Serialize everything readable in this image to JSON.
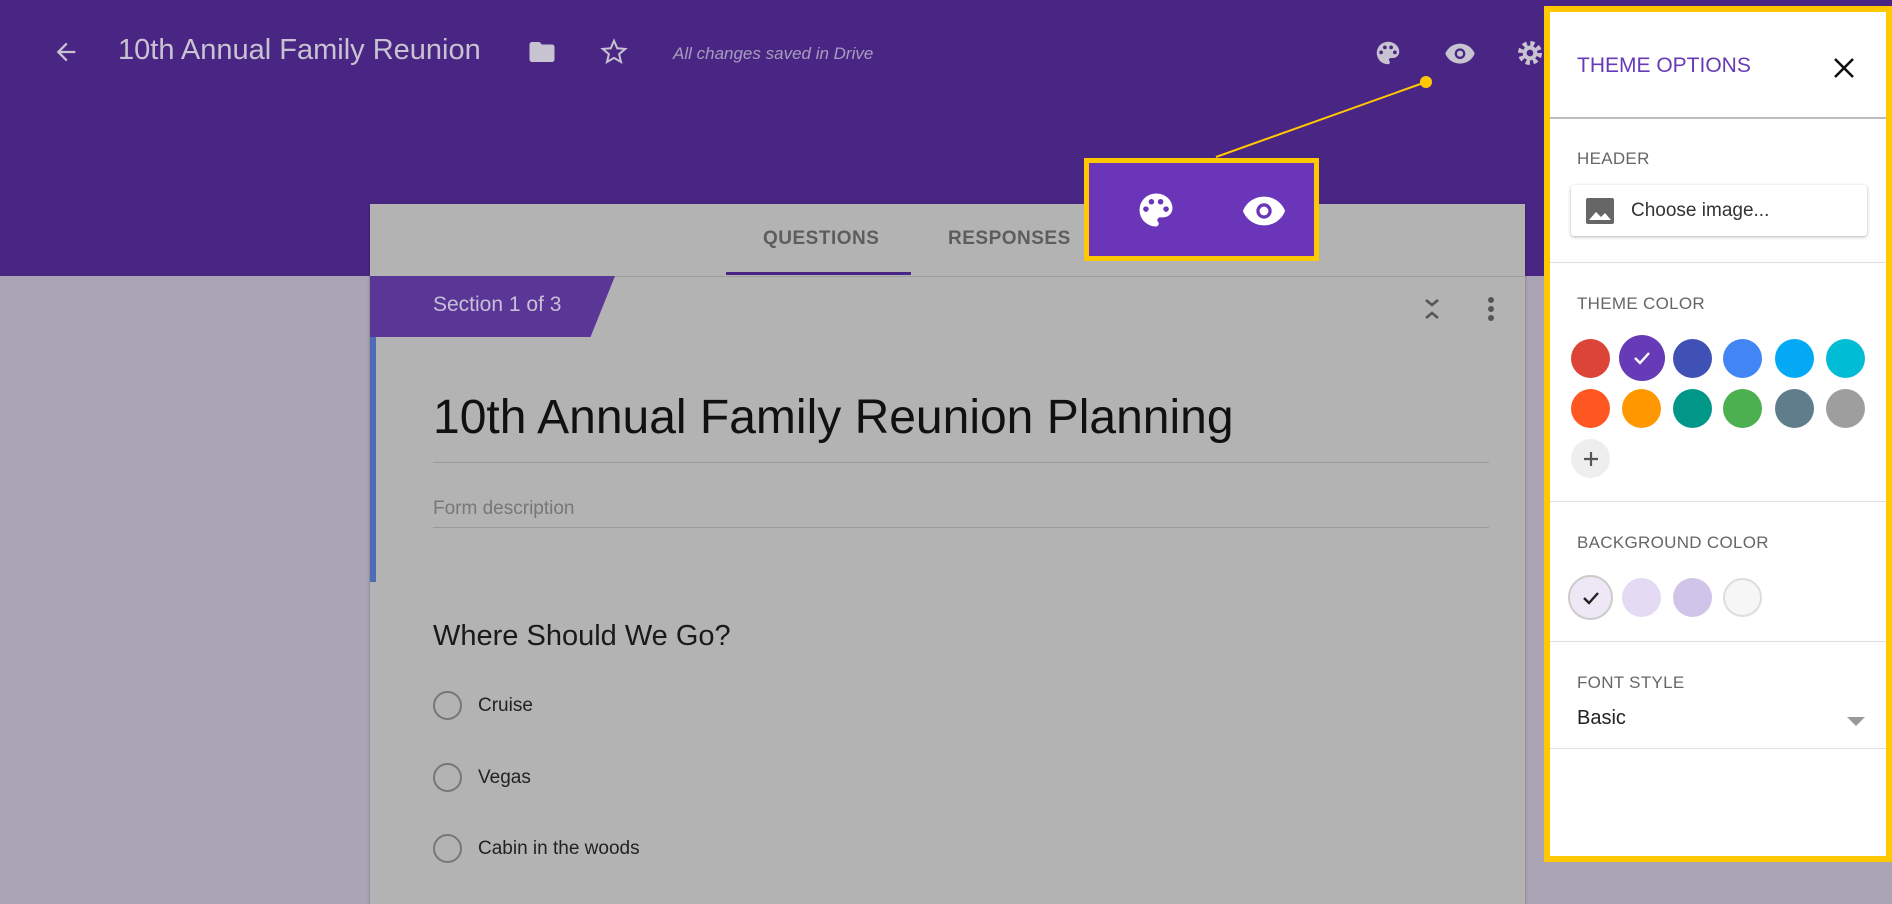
{
  "topbar": {
    "title": "10th Annual Family Reunion",
    "saved_status": "All changes saved in Drive",
    "icons": [
      "back-arrow-icon",
      "folder-icon",
      "star-icon",
      "palette-icon",
      "eye-icon",
      "gear-icon"
    ]
  },
  "tabs": [
    {
      "label": "QUESTIONS",
      "active": true
    },
    {
      "label": "RESPONSES",
      "active": false
    }
  ],
  "section": {
    "label": "Section 1 of 3"
  },
  "form": {
    "title": "10th Annual Family Reunion Planning",
    "description_placeholder": "Form description",
    "question": {
      "title": "Where Should We Go?",
      "options": [
        "Cruise",
        "Vegas",
        "Cabin in the woods"
      ]
    }
  },
  "panel": {
    "title": "THEME OPTIONS",
    "header_label": "HEADER",
    "choose_image": "Choose image...",
    "theme_color_label": "THEME COLOR",
    "theme_colors": [
      "#db4437",
      "#673ab7",
      "#3f51b5",
      "#4285f4",
      "#03a9f4",
      "#00bcd4",
      "#ff5722",
      "#ff9800",
      "#009688",
      "#4caf50",
      "#607d8b",
      "#9e9e9e"
    ],
    "theme_selected": 1,
    "background_color_label": "BACKGROUND COLOR",
    "background_colors": [
      "#ede7f6",
      "#e4daf3",
      "#d1c4e9",
      "#f6f6f6"
    ],
    "background_selected": 0,
    "font_style_label": "FONT STYLE",
    "font_style_value": "Basic"
  },
  "colors": {
    "accent": "#4a2684",
    "highlight": "#ffc800"
  }
}
